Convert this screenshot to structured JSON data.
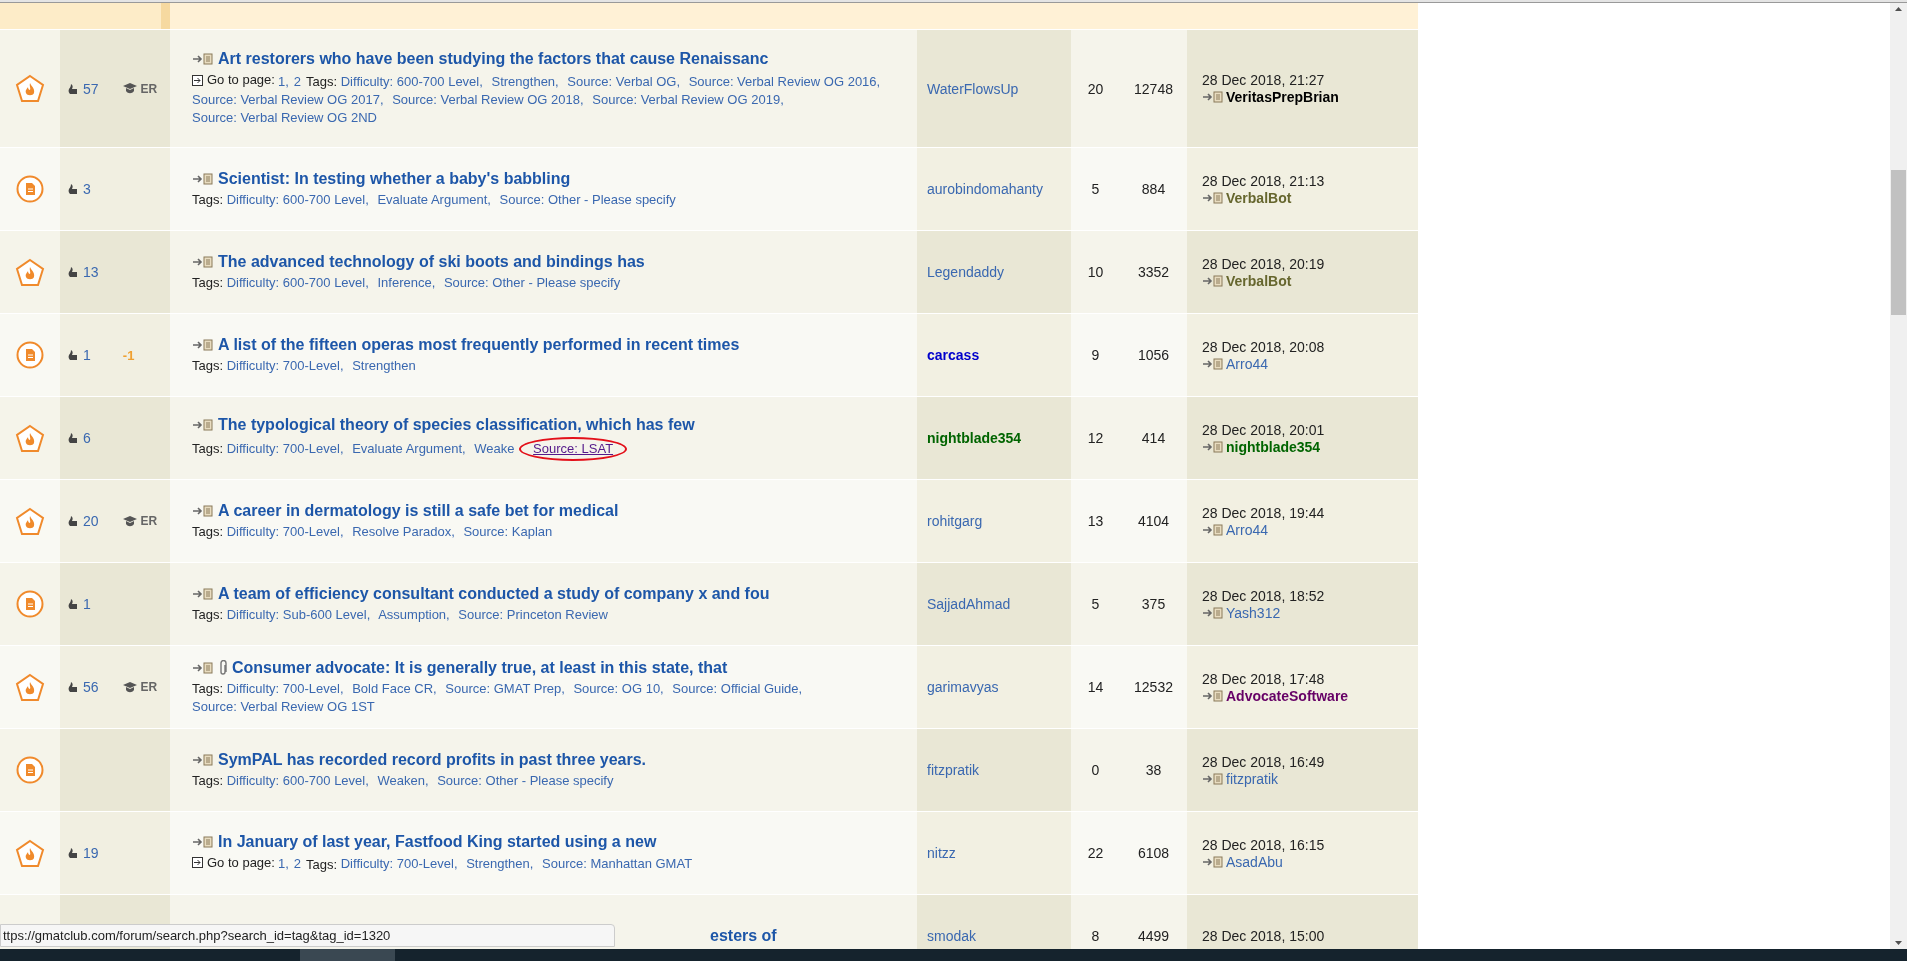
{
  "rows": [
    {
      "kind": "hot",
      "kudos": "57",
      "badge": "ER",
      "title": "Art restorers who have been studying the factors that cause Renaissanc",
      "attachment": false,
      "pages_label": "Go to page:",
      "pages": [
        "1,",
        "2"
      ],
      "tags_label": "Tags:",
      "tags": [
        {
          "text": "Difficulty: 600-700 Level,",
          "circled": false
        },
        {
          "text": "Strengthen,",
          "circled": false
        },
        {
          "text": "Source: Verbal OG,",
          "circled": false
        },
        {
          "text": "Source: Verbal Review OG 2016,",
          "circled": false
        },
        {
          "text": "Source: Verbal Review OG 2017,",
          "circled": false
        },
        {
          "text": "Source: Verbal Review OG 2018,",
          "circled": false
        },
        {
          "text": "Source: Verbal Review OG 2019,",
          "circled": false
        },
        {
          "text": "Source: Verbal Review OG 2ND",
          "circled": false
        }
      ],
      "author": {
        "name": "WaterFlowsUp",
        "color": "#3a68b0",
        "bold": false
      },
      "replies": "20",
      "views": "12748",
      "date": "28 Dec 2018, 21:27",
      "last_poster": {
        "name": "VeritasPrepBrian",
        "color": "#000000",
        "bold": true
      }
    },
    {
      "kind": "doc",
      "kudos": "3",
      "title": "Scientist: In testing whether a baby's babbling",
      "attachment": false,
      "tags_label": "Tags:",
      "tags": [
        {
          "text": "Difficulty: 600-700 Level,",
          "circled": false
        },
        {
          "text": "Evaluate Argument,",
          "circled": false
        },
        {
          "text": "Source: Other - Please specify",
          "circled": false
        }
      ],
      "author": {
        "name": "aurobindomahanty",
        "color": "#3a68b0",
        "bold": false
      },
      "replies": "5",
      "views": "884",
      "date": "28 Dec 2018, 21:13",
      "last_poster": {
        "name": "VerbalBot",
        "color": "#66662e",
        "bold": true
      }
    },
    {
      "kind": "hot",
      "kudos": "13",
      "title": "The advanced technology of ski boots and bindings has",
      "attachment": false,
      "tags_label": "Tags:",
      "tags": [
        {
          "text": "Difficulty: 600-700 Level,",
          "circled": false
        },
        {
          "text": "Inference,",
          "circled": false
        },
        {
          "text": "Source: Other - Please specify",
          "circled": false
        }
      ],
      "author": {
        "name": "Legendaddy",
        "color": "#3a68b0",
        "bold": false
      },
      "replies": "10",
      "views": "3352",
      "date": "28 Dec 2018, 20:19",
      "last_poster": {
        "name": "VerbalBot",
        "color": "#66662e",
        "bold": true
      }
    },
    {
      "kind": "doc",
      "kudos": "1",
      "delta": "-1",
      "title": "A list of the fifteen operas most frequently performed in recent times",
      "attachment": false,
      "tags_label": "Tags:",
      "tags": [
        {
          "text": "Difficulty: 700-Level,",
          "circled": false
        },
        {
          "text": "Strengthen",
          "circled": false
        }
      ],
      "author": {
        "name": "carcass",
        "color": "#0000cc",
        "bold": true
      },
      "replies": "9",
      "views": "1056",
      "date": "28 Dec 2018, 20:08",
      "last_poster": {
        "name": "Arro44",
        "color": "#3a68b0",
        "bold": false
      }
    },
    {
      "kind": "hot",
      "kudos": "6",
      "title": "The typological theory of species classification, which has few",
      "attachment": false,
      "tags_label": "Tags:",
      "tags": [
        {
          "text": "Difficulty: 700-Level,",
          "circled": false
        },
        {
          "text": "Evaluate Argument,",
          "circled": false
        },
        {
          "text": "Weake",
          "circled": false
        },
        {
          "text": "Source: LSAT",
          "circled": true
        }
      ],
      "author": {
        "name": "nightblade354",
        "color": "#006400",
        "bold": true
      },
      "replies": "12",
      "views": "414",
      "date": "28 Dec 2018, 20:01",
      "last_poster": {
        "name": "nightblade354",
        "color": "#006400",
        "bold": true
      }
    },
    {
      "kind": "hot",
      "kudos": "20",
      "badge": "ER",
      "title": "A career in dermatology is still a safe bet for medical",
      "attachment": false,
      "tags_label": "Tags:",
      "tags": [
        {
          "text": "Difficulty: 700-Level,",
          "circled": false
        },
        {
          "text": "Resolve Paradox,",
          "circled": false
        },
        {
          "text": "Source: Kaplan",
          "circled": false
        }
      ],
      "author": {
        "name": "rohitgarg",
        "color": "#3a68b0",
        "bold": false
      },
      "replies": "13",
      "views": "4104",
      "date": "28 Dec 2018, 19:44",
      "last_poster": {
        "name": "Arro44",
        "color": "#3a68b0",
        "bold": false
      }
    },
    {
      "kind": "doc",
      "kudos": "1",
      "title": "A team of efficiency consultant conducted a study of company x and fou",
      "attachment": false,
      "tags_label": "Tags:",
      "tags": [
        {
          "text": "Difficulty: Sub-600 Level,",
          "circled": false
        },
        {
          "text": "Assumption,",
          "circled": false
        },
        {
          "text": "Source: Princeton Review",
          "circled": false
        }
      ],
      "author": {
        "name": "SajjadAhmad",
        "color": "#3a68b0",
        "bold": false
      },
      "replies": "5",
      "views": "375",
      "date": "28 Dec 2018, 18:52",
      "last_poster": {
        "name": "Yash312",
        "color": "#3a68b0",
        "bold": false
      }
    },
    {
      "kind": "hot",
      "kudos": "56",
      "badge": "ER",
      "title": "Consumer advocate: It is generally true, at least in this state, that",
      "attachment": true,
      "tags_label": "Tags:",
      "tags": [
        {
          "text": "Difficulty: 700-Level,",
          "circled": false
        },
        {
          "text": "Bold Face CR,",
          "circled": false
        },
        {
          "text": "Source: GMAT Prep,",
          "circled": false
        },
        {
          "text": "Source: OG 10,",
          "circled": false
        },
        {
          "text": "Source: Official Guide,",
          "circled": false
        },
        {
          "text": "Source: Verbal Review OG 1ST",
          "circled": false
        }
      ],
      "author": {
        "name": "garimavyas",
        "color": "#3a68b0",
        "bold": false
      },
      "replies": "14",
      "views": "12532",
      "date": "28 Dec 2018, 17:48",
      "last_poster": {
        "name": "AdvocateSoftware",
        "color": "#660066",
        "bold": true
      }
    },
    {
      "kind": "doc",
      "title": "SymPAL has recorded record profits in past three years.",
      "attachment": false,
      "tags_label": "Tags:",
      "tags": [
        {
          "text": "Difficulty: 600-700 Level,",
          "circled": false
        },
        {
          "text": "Weaken,",
          "circled": false
        },
        {
          "text": "Source: Other - Please specify",
          "circled": false
        }
      ],
      "author": {
        "name": "fitzpratik",
        "color": "#3a68b0",
        "bold": false
      },
      "replies": "0",
      "views": "38",
      "date": "28 Dec 2018, 16:49",
      "last_poster": {
        "name": "fitzpratik",
        "color": "#3a68b0",
        "bold": false
      }
    },
    {
      "kind": "hot",
      "kudos": "19",
      "title": "In January of last year, Fastfood King started using a new",
      "attachment": false,
      "pages_label": "Go to page:",
      "pages": [
        "1,",
        "2"
      ],
      "tags_label": "Tags:",
      "tags": [
        {
          "text": "Difficulty: 700-Level,",
          "circled": false
        },
        {
          "text": "Strengthen,",
          "circled": false
        },
        {
          "text": "Source: Manhattan GMAT",
          "circled": false
        }
      ],
      "author": {
        "name": "nitzz",
        "color": "#3a68b0",
        "bold": false
      },
      "replies": "22",
      "views": "6108",
      "date": "28 Dec 2018, 16:15",
      "last_poster": {
        "name": "AsadAbu",
        "color": "#3a68b0",
        "bold": false
      }
    },
    {
      "kind": "partial",
      "title": "esters of",
      "attachment": false,
      "author": {
        "name": "smodak",
        "color": "#3a68b0",
        "bold": false
      },
      "replies": "8",
      "views": "4499",
      "date": "28 Dec 2018, 15:00"
    }
  ],
  "status_url": "ttps://gmatclub.com/forum/search.php?search_id=tag&tag_id=1320"
}
